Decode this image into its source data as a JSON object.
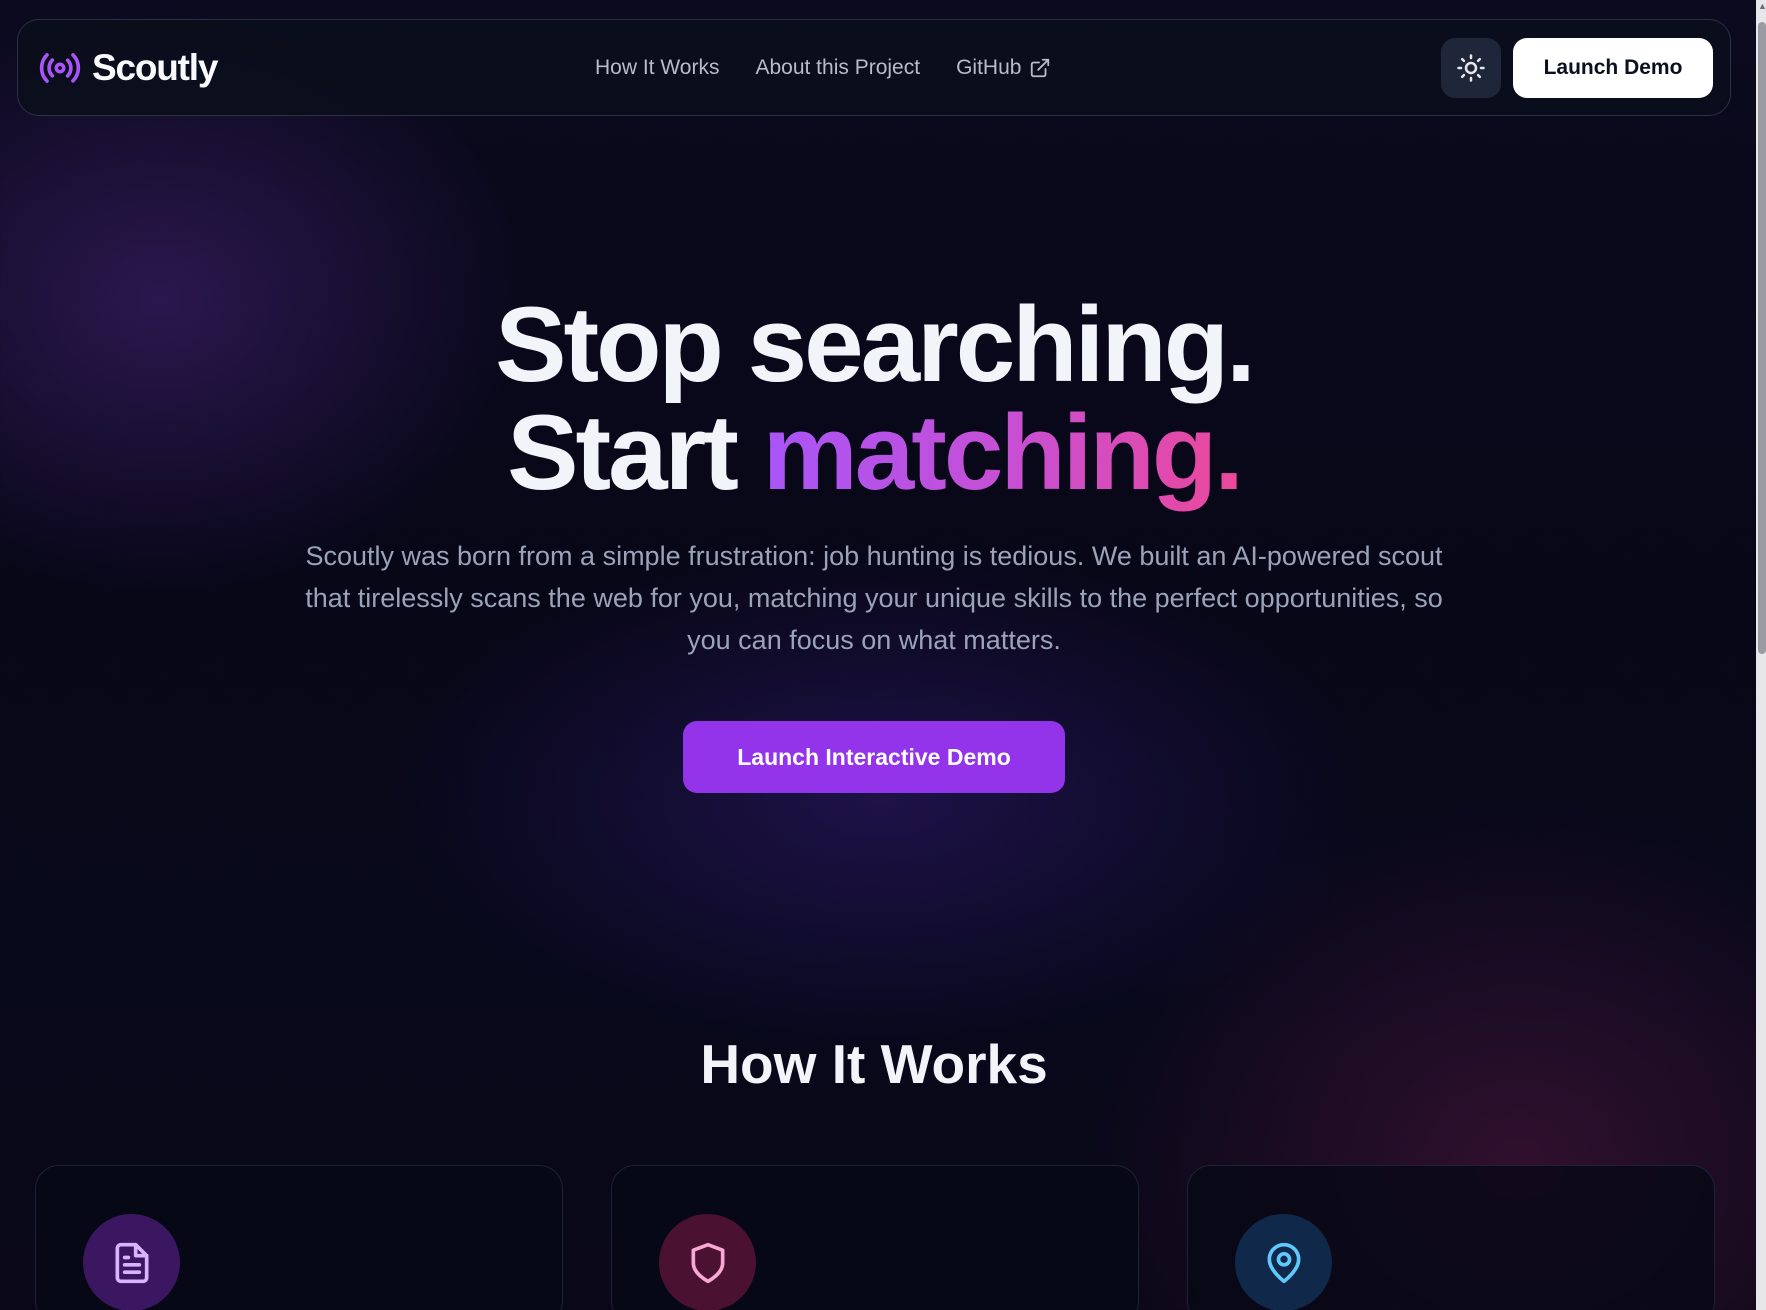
{
  "brand": {
    "name": "Scoutly",
    "icon": "radio-broadcast-icon",
    "accent": "#a855f7"
  },
  "nav": {
    "links": [
      {
        "label": "How It Works"
      },
      {
        "label": "About this Project"
      },
      {
        "label": "GitHub",
        "icon": "external-link-icon"
      }
    ],
    "theme_toggle_icon": "sun-icon",
    "launch_label": "Launch Demo"
  },
  "hero": {
    "title_line1": "Stop searching.",
    "title_line2_plain": "Start ",
    "title_line2_gradient": "matching.",
    "subtitle": "Scoutly was born from a simple frustration: job hunting is tedious. We built an AI-powered scout that tirelessly scans the web for you, matching your unique skills to the perfect opportunities, so you can focus on what matters.",
    "cta_label": "Launch Interactive Demo",
    "gradient_from": "#a855f7",
    "gradient_to": "#ec4899"
  },
  "how_it_works": {
    "title": "How It Works",
    "cards": [
      {
        "icon": "document-icon",
        "icon_color": "#d8b4fe",
        "bg": "#3a1760"
      },
      {
        "icon": "shield-icon",
        "icon_color": "#f9a8d4",
        "bg": "#4a1130"
      },
      {
        "icon": "map-pin-icon",
        "icon_color": "#60c8fa",
        "bg": "#10284a"
      }
    ]
  },
  "colors": {
    "cta_bg": "#9333ea",
    "nav_border": "#2b3143"
  }
}
